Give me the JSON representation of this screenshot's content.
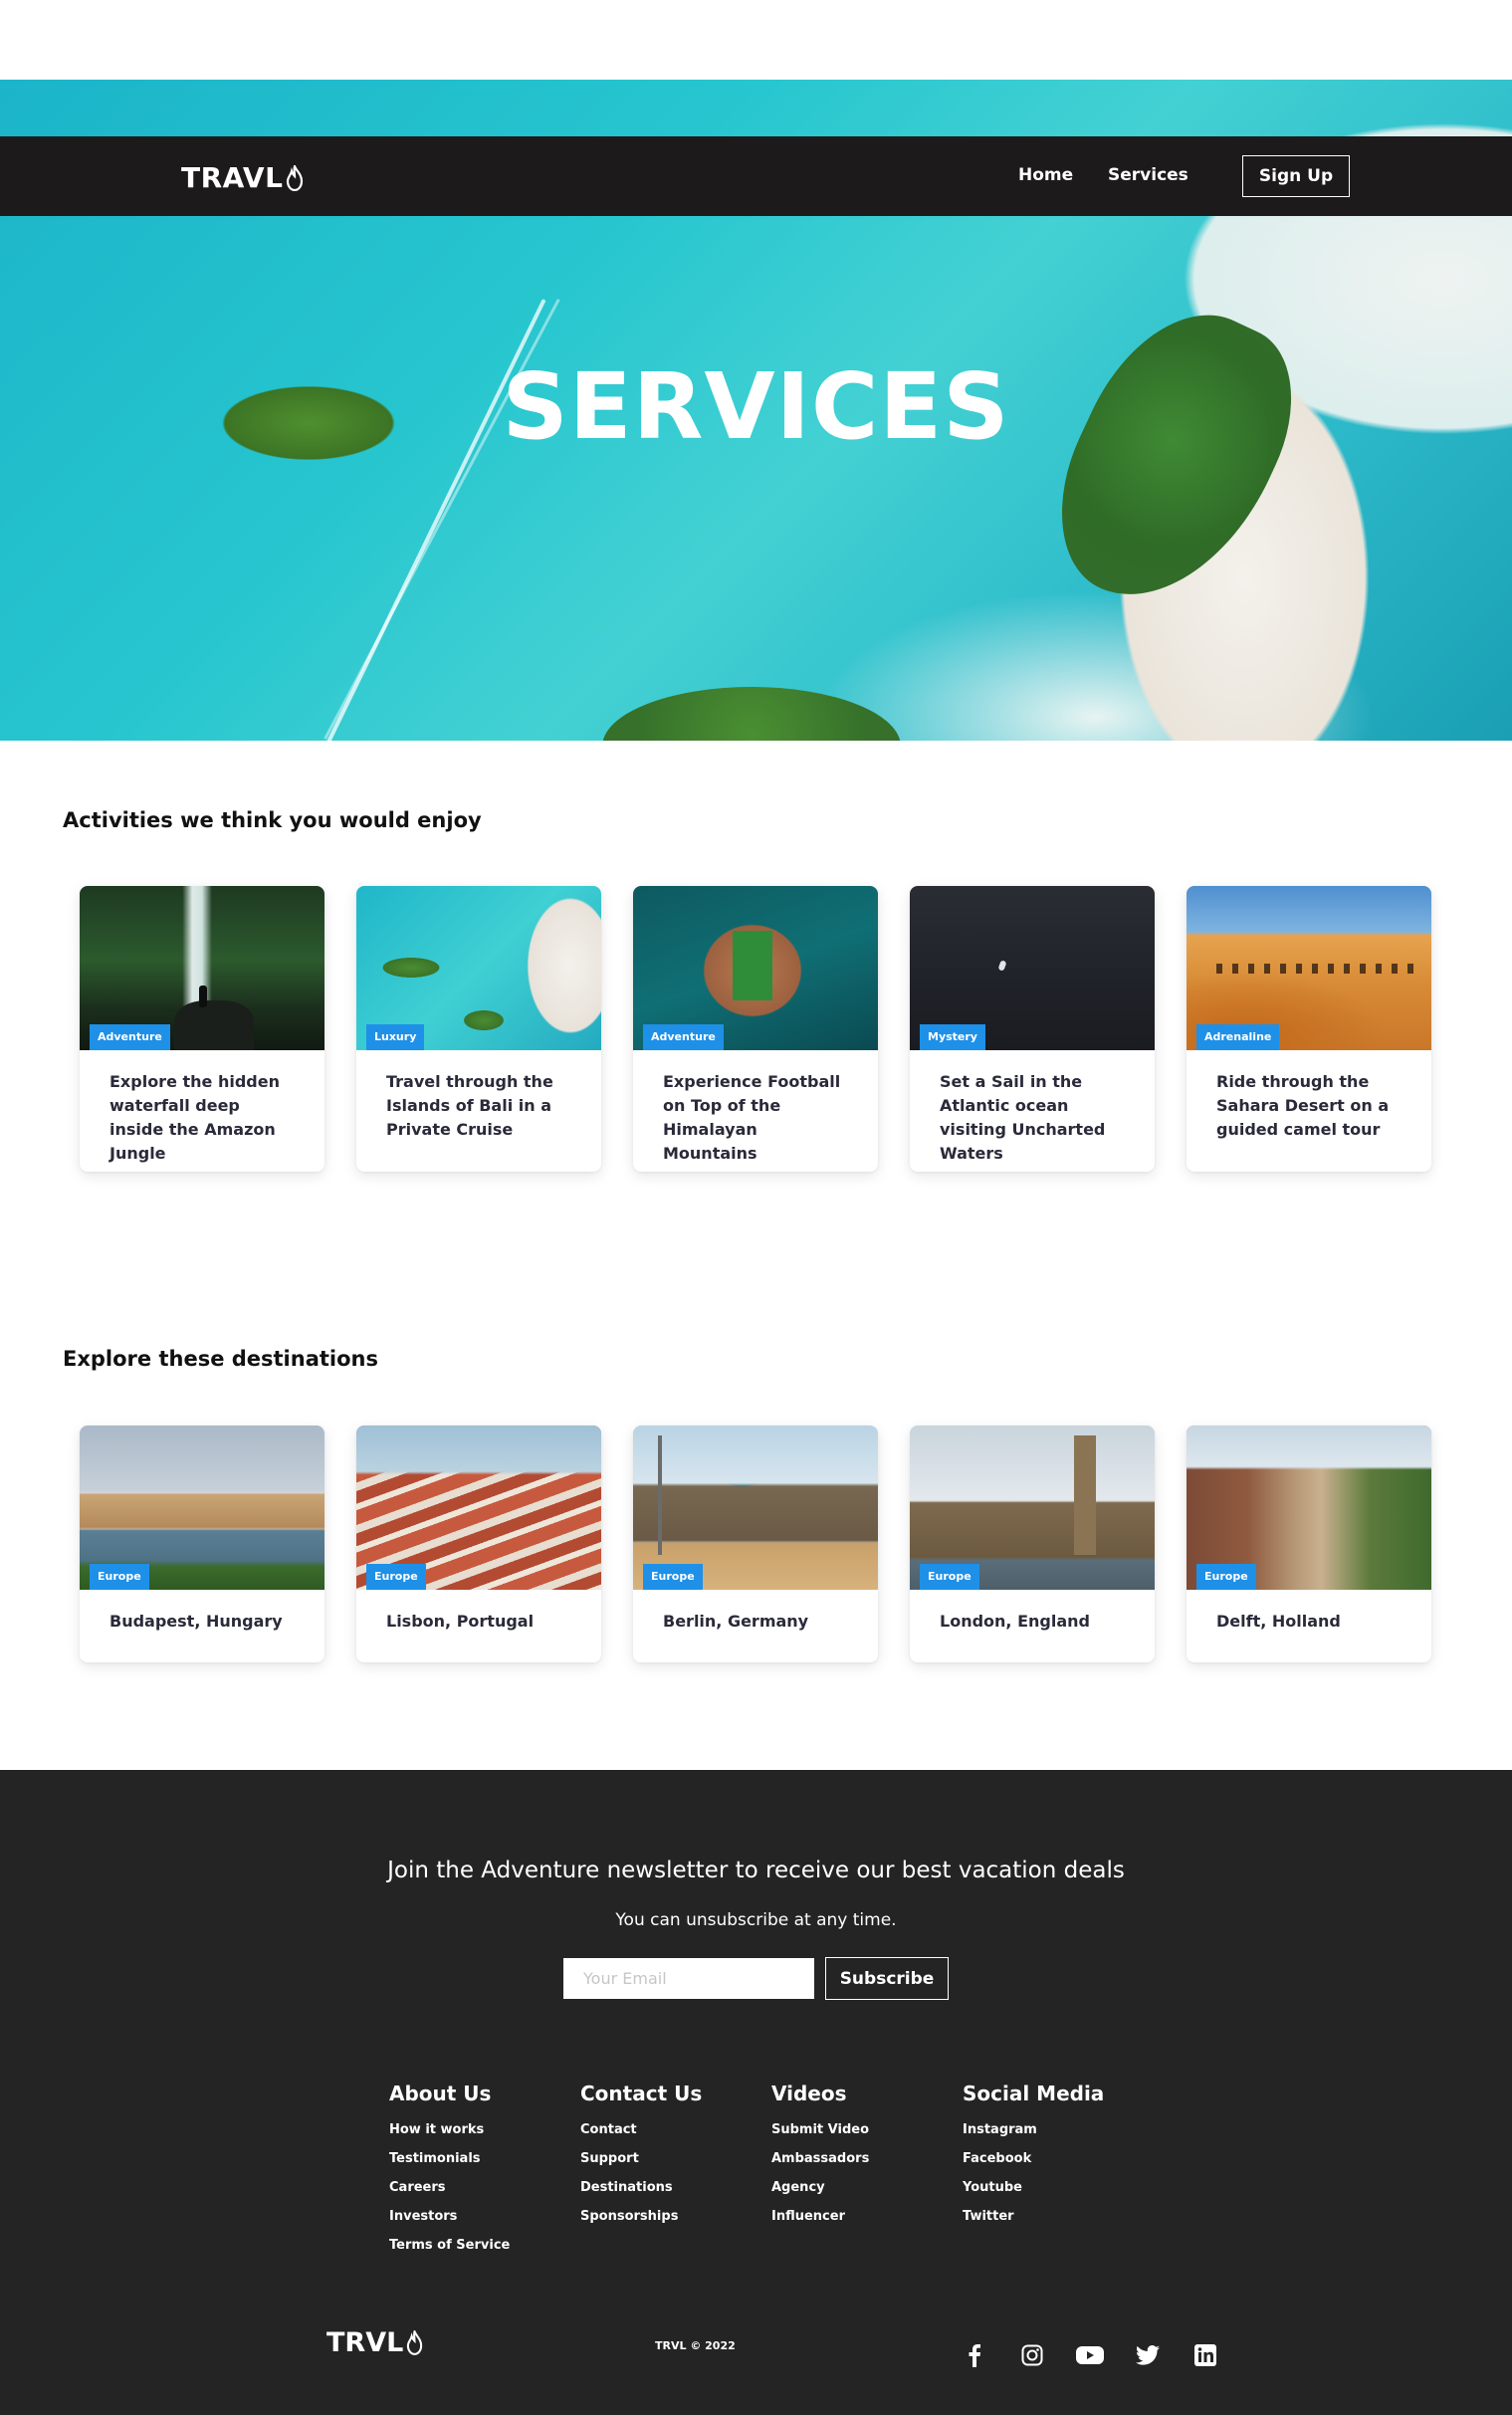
{
  "brand": {
    "logo_text": "TRAVL"
  },
  "nav": {
    "home": "Home",
    "services": "Services",
    "signup": "Sign Up"
  },
  "hero": {
    "title": "SERVICES"
  },
  "activities": {
    "title": "Activities we think you would enjoy",
    "cards": [
      {
        "tag": "Adventure",
        "text": "Explore the hidden waterfall deep inside the Amazon Jungle"
      },
      {
        "tag": "Luxury",
        "text": "Travel through the Islands of Bali in a Private Cruise"
      },
      {
        "tag": "Adventure",
        "text": "Experience Football on Top of the Himalayan Mountains"
      },
      {
        "tag": "Mystery",
        "text": "Set a Sail in the Atlantic ocean visiting Uncharted Waters"
      },
      {
        "tag": "Adrenaline",
        "text": "Ride through the Sahara Desert on a guided camel tour"
      }
    ]
  },
  "destinations": {
    "title": "Explore these destinations",
    "cards": [
      {
        "tag": "Europe",
        "text": "Budapest, Hungary"
      },
      {
        "tag": "Europe",
        "text": "Lisbon, Portugal"
      },
      {
        "tag": "Europe",
        "text": "Berlin, Germany"
      },
      {
        "tag": "Europe",
        "text": "London, England"
      },
      {
        "tag": "Europe",
        "text": "Delft, Holland"
      }
    ]
  },
  "newsletter": {
    "title": "Join the Adventure newsletter to receive our best vacation deals",
    "subtitle": "You can unsubscribe at any time.",
    "email_placeholder": "Your Email",
    "subscribe": "Subscribe"
  },
  "footer": {
    "columns": [
      {
        "heading": "About Us",
        "links": [
          "How it works",
          "Testimonials",
          "Careers",
          "Investors",
          "Terms of Service"
        ]
      },
      {
        "heading": "Contact Us",
        "links": [
          "Contact",
          "Support",
          "Destinations",
          "Sponsorships"
        ]
      },
      {
        "heading": "Videos",
        "links": [
          "Submit Video",
          "Ambassadors",
          "Agency",
          "Influencer"
        ]
      },
      {
        "heading": "Social Media",
        "links": [
          "Instagram",
          "Facebook",
          "Youtube",
          "Twitter"
        ]
      }
    ],
    "logo_text": "TRVL",
    "copyright": "TRVL © 2022",
    "social_icons": [
      "facebook-icon",
      "instagram-icon",
      "youtube-icon",
      "twitter-icon",
      "linkedin-icon"
    ]
  },
  "colors": {
    "navbar": "#1c1a1a",
    "tag": "#1e90e8",
    "footer": "#242424"
  }
}
